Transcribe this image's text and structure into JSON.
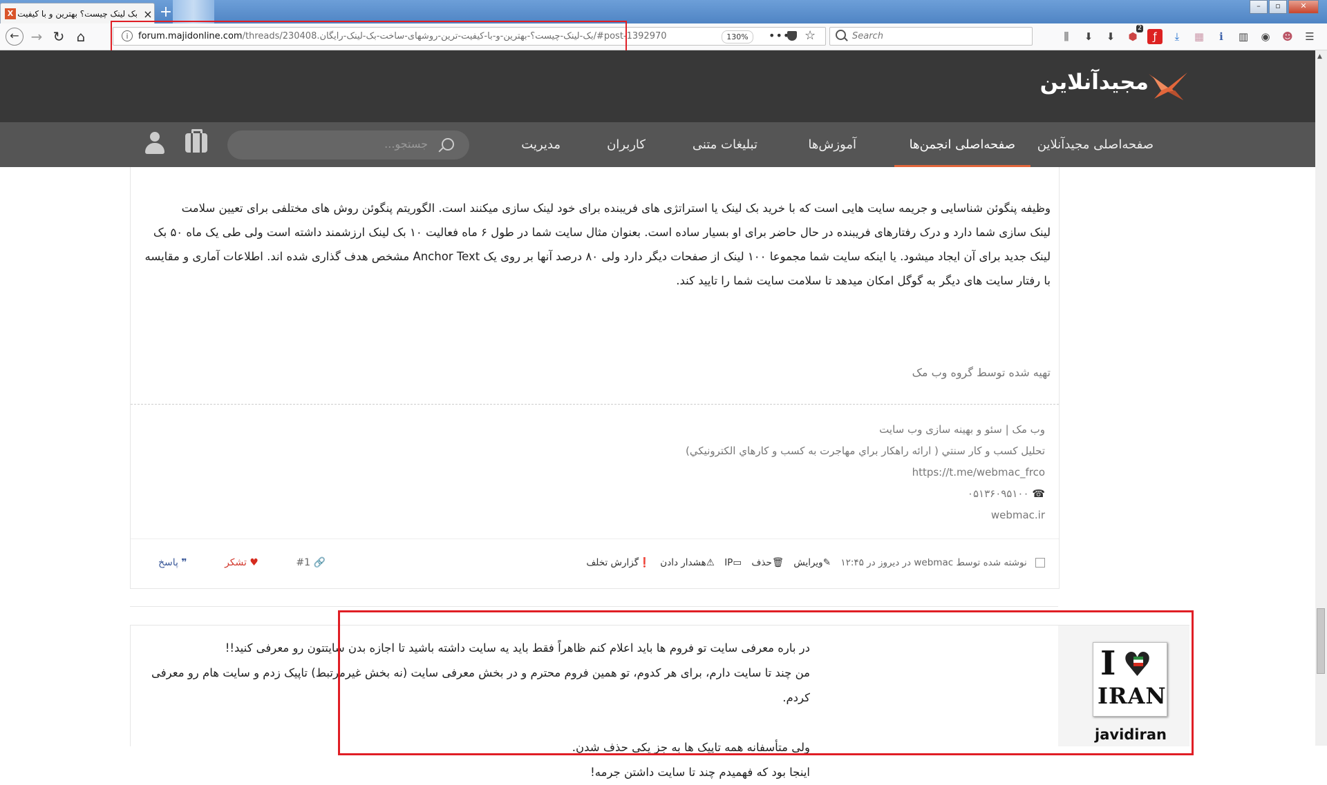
{
  "browser": {
    "tab_title": "بک لینک چیست؟ بهترین و با کیفیت ت",
    "tab_favicon": "X",
    "url_host": "forum.majidonline.com",
    "url_path": "/threads/230408.بک-لینک-چیست؟-بهترین-و-با-کیفیت-ترین-روشهای-ساخت-بک-لینک-رایگان/#post-1392970",
    "zoom": "130%",
    "search_placeholder": "Search",
    "badge_count": "2"
  },
  "site": {
    "logo_text": "مجیدآنلاین",
    "nav": {
      "home": "صفحه‌اصلی مجیدآنلاین",
      "forums_home": "صفحه‌اصلی انجمن‌ها",
      "tutorials": "آموزش‌ها",
      "text_ads": "تبلیغات متنی",
      "users": "کاربران",
      "admin": "مدیریت",
      "search_placeholder": "جستجو..."
    }
  },
  "post1": {
    "body_lines": [
      "وظیفه پنگوئن شناسایی و جریمه سایت هایی است که با خرید بک لینک یا استراتژی های فریبنده برای خود لینک سازی میکنند است. الگوریتم پنگوئن روش های مختلفی برای تعیین سلامت",
      "لینک سازی شما دارد و درک رفتارهای فریبنده در حال حاضر برای او بسیار ساده است. بعنوان مثال سایت شما در طول ۶ ماه فعالیت ۱۰ بک لینک ارزشمند داشته است ولی طی یک ماه ۵۰ بک",
      "لینک جدید برای آن ایجاد میشود. یا اینکه سایت شما مجموعا ۱۰۰ لینک از صفحات دیگر دارد ولی ۸۰ درصد آنها بر روی یک Anchor Text مشخص هدف گذاری شده اند. اطلاعات آماری و مقایسه",
      "با رفتار سایت های دیگر به گوگل امکان میدهد تا سلامت سایت شما را تایید کند."
    ],
    "prepared_by": "تهیه شده توسط گروه وب مک",
    "signature": {
      "line1": "وب مک | سئو و بهینه سازی وب سایت",
      "line2": "تحلیل کسب و کار سنتي ( ارائه راهكار براي مهاجرت به كسب و كارهاي الكترونيكي)",
      "telegram": "https://t.me/webmac_frco",
      "phone": "۰۵۱۳۶۰۹۵۱۰۰",
      "site": "webmac.ir"
    },
    "meta": {
      "posted_prefix": "نوشته شده توسط",
      "author": "webmac",
      "time": "در دیروز در ۱۲:۴۵",
      "edit": "ویرایش",
      "delete": "حذف",
      "ip": "IP",
      "warn": "هشدار دادن",
      "report": "گزارش تخلف"
    },
    "actions": {
      "reply": "پاسخ",
      "thanks": "تشکر",
      "number": "#1"
    }
  },
  "post2": {
    "body_lines": [
      "در باره معرفی سایت تو فروم ها باید اعلام کنم ظاهراً فقط باید یه سایت داشته باشید تا اجازه بدن سایتتون رو معرفی کنید!!",
      "من چند تا سایت دارم، برای هر کدوم، تو همین فروم محترم و در بخش معرفی سایت (نه بخش غیرمرتبط) تاپیک زدم و سایت هام رو معرفی کردم.",
      "",
      "ولی متأسفانه همه تاپیک ها به جز یکی حذف شدن.",
      "اینجا بود که فهمیدم چند تا سایت داشتن جرمه!"
    ],
    "username": "javidiran",
    "avatar_text_top": "I",
    "avatar_text_bottom": "IRAN"
  },
  "colors": {
    "header_bg": "#383838",
    "nav_bg": "#555555",
    "accent": "#e2663b",
    "highlight_box": "#e01e25"
  }
}
